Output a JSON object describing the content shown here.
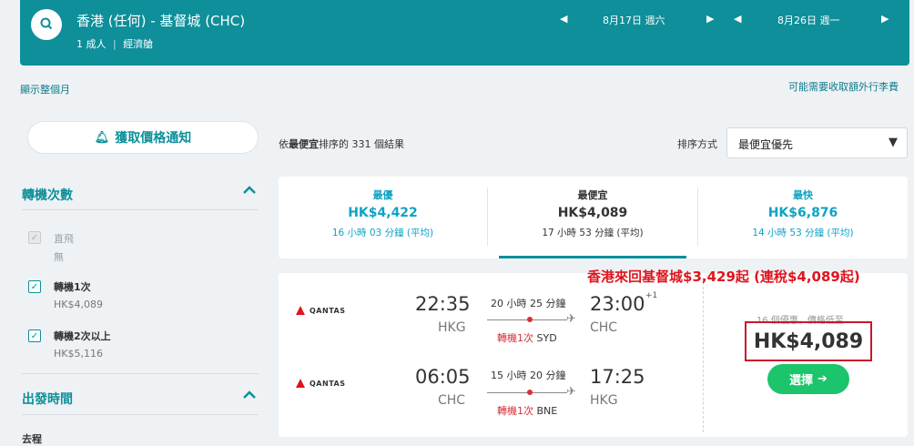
{
  "header": {
    "route": "香港 (任何) - 基督城 (CHC)",
    "passengers": "1 成人",
    "cabin": "經濟艙",
    "depart_date": "8月17日 週六",
    "return_date": "8月26日 週一"
  },
  "links": {
    "show_month": "顯示整個月",
    "extra_fees": "可能需要收取額外行李費"
  },
  "sidebar": {
    "alert_button": "獲取價格通知",
    "stops_title": "轉機次數",
    "stops": [
      {
        "label": "直飛",
        "sub": "無",
        "checked": true,
        "disabled": true
      },
      {
        "label": "轉機1次",
        "sub": "HK$4,089",
        "checked": true,
        "disabled": false
      },
      {
        "label": "轉機2次以上",
        "sub": "HK$5,116",
        "checked": true,
        "disabled": false
      }
    ],
    "departure_title": "出發時間",
    "departure_sub": "去程"
  },
  "sort": {
    "results_prefix": "依",
    "results_bold": "最便宜",
    "results_suffix": "排序的 331 個結果",
    "label": "排序方式",
    "value": "最便宜優先"
  },
  "tabs": [
    {
      "title": "最優",
      "price": "HK$4,422",
      "duration": "16 小時 03 分鐘 (平均)"
    },
    {
      "title": "最便宜",
      "price": "HK$4,089",
      "duration": "17 小時 53 分鐘 (平均)"
    },
    {
      "title": "最快",
      "price": "HK$6,876",
      "duration": "14 小時 53 分鐘 (平均)"
    }
  ],
  "banner": "香港來回基督城$3,429起 (連稅$4,089起)",
  "flight": {
    "airline": "QANTAS",
    "outbound": {
      "dep_time": "22:35",
      "dep_apt": "HKG",
      "duration": "20 小時 25 分鐘",
      "arr_time": "23:00",
      "day_offset": "+1",
      "arr_apt": "CHC",
      "stops": "轉機1次",
      "via": "SYD"
    },
    "inbound": {
      "dep_time": "06:05",
      "dep_apt": "CHC",
      "duration": "15 小時 20 分鐘",
      "arr_time": "17:25",
      "arr_apt": "HKG",
      "stops": "轉機1次",
      "via": "BNE"
    },
    "offers_note": "16 個優惠，價格低至",
    "price": "HK$4,089",
    "select_label": "選擇"
  }
}
